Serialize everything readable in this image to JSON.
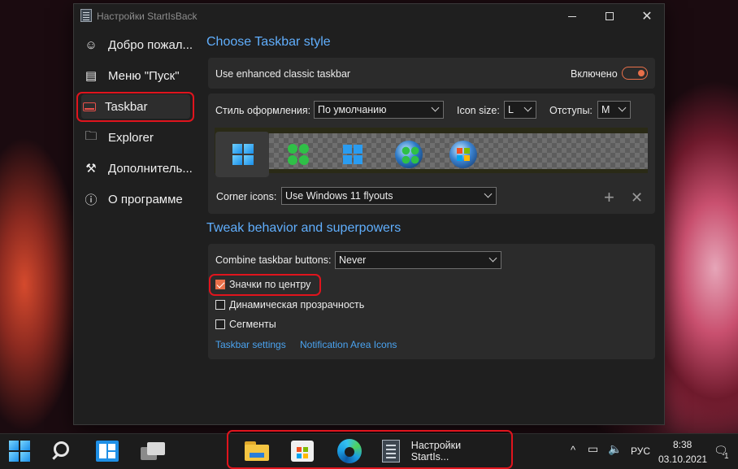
{
  "window": {
    "title": "Настройки StartIsBack"
  },
  "sidebar": {
    "items": [
      {
        "label": "Добро пожал...",
        "icon": "smile-icon"
      },
      {
        "label": "Меню \"Пуск\"",
        "icon": "start-menu-icon"
      },
      {
        "label": "Taskbar",
        "icon": "taskbar-icon",
        "active": true
      },
      {
        "label": "Explorer",
        "icon": "folder-icon"
      },
      {
        "label": "Дополнитель...",
        "icon": "wrench-icon"
      },
      {
        "label": "О программе",
        "icon": "info-icon"
      }
    ]
  },
  "taskbar_style": {
    "section_title": "Choose Taskbar style",
    "enhanced_label": "Use enhanced classic taskbar",
    "enhanced_state": "Включено",
    "style_label": "Стиль оформления:",
    "style_value": "По умолчанию",
    "icon_size_label": "Icon size:",
    "icon_size_value": "L",
    "spacing_label": "Отступы:",
    "spacing_value": "M",
    "corner_icons_label": "Corner icons:",
    "corner_icons_value": "Use Windows 11 flyouts",
    "add_icon": "plus-icon",
    "remove_icon": "x-icon"
  },
  "behavior": {
    "section_title": "Tweak behavior and superpowers",
    "combine_label": "Combine taskbar buttons:",
    "combine_value": "Never",
    "checkboxes": [
      {
        "label": "Значки по центру",
        "checked": true
      },
      {
        "label": "Динамическая прозрачность",
        "checked": false
      },
      {
        "label": "Сегменты",
        "checked": false
      }
    ],
    "link_taskbar_settings": "Taskbar settings",
    "link_notification_icons": "Notification Area Icons"
  },
  "taskbar": {
    "app_label": "Настройки StartIs...",
    "language": "РУС",
    "time": "8:38",
    "date": "03.10.2021",
    "notification_count": "1"
  },
  "colors": {
    "accent_blue": "#60aefc",
    "accent_orange": "#e8704a",
    "highlight_red": "#e0141d"
  }
}
